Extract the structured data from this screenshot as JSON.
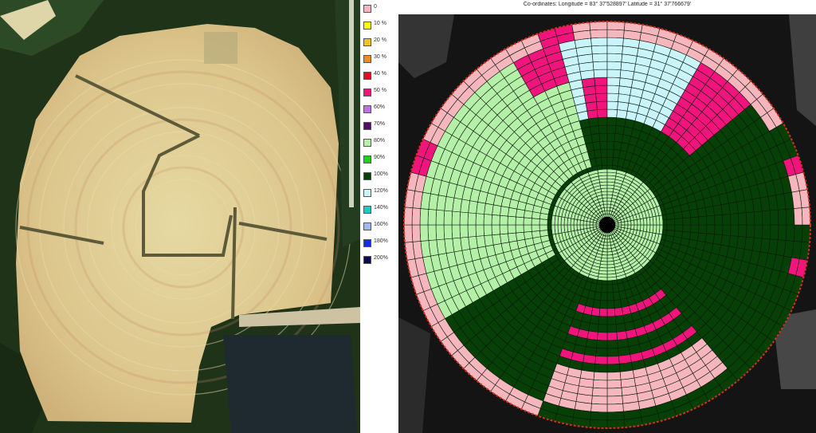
{
  "coordinates_text": "Co-ordinates: Longitude = 83° 37'528897' Latitude = 31° 37'766679'",
  "legend": {
    "items": [
      {
        "label": "0",
        "color": "#f6b6be"
      },
      {
        "label": "10 %",
        "color": "#ffff00"
      },
      {
        "label": "20 %",
        "color": "#f5c518"
      },
      {
        "label": "30 %",
        "color": "#f08a24"
      },
      {
        "label": "40 %",
        "color": "#e0101e"
      },
      {
        "label": "50 %",
        "color": "#f0147c"
      },
      {
        "label": "60%",
        "color": "#c070e0"
      },
      {
        "label": "70%",
        "color": "#5a0a6a"
      },
      {
        "label": "80%",
        "color": "#b4f0a8"
      },
      {
        "label": "90%",
        "color": "#20d020"
      },
      {
        "label": "100%",
        "color": "#064006"
      },
      {
        "label": "120%",
        "color": "#c8f4fa"
      },
      {
        "label": "140%",
        "color": "#20c8c8"
      },
      {
        "label": "160%",
        "color": "#a0b8ec"
      },
      {
        "label": "180%",
        "color": "#1030e0"
      },
      {
        "label": "200%",
        "color": "#0a0a50"
      }
    ]
  },
  "colors": {
    "pink": "#f6b6be",
    "magenta": "#f0147c",
    "light_green": "#b4f0a8",
    "dark_green": "#064006",
    "light_cyan": "#c8f4fa",
    "circle_outline": "#d03020"
  }
}
